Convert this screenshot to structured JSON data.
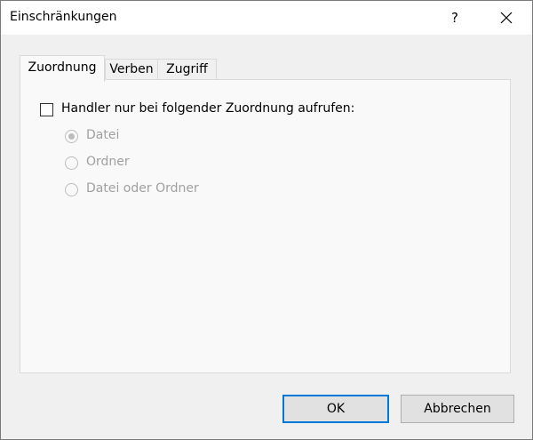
{
  "window": {
    "title": "Einschränkungen",
    "help_label": "?"
  },
  "tabs": [
    {
      "label": "Zuordnung",
      "active": true
    },
    {
      "label": "Verben",
      "active": false
    },
    {
      "label": "Zugriff",
      "active": false
    }
  ],
  "zuordnung": {
    "checkbox_label": "Handler nur bei folgender Zuordnung aufrufen:",
    "checkbox_checked": false,
    "options": [
      {
        "label": "Datei",
        "selected": true,
        "enabled": false
      },
      {
        "label": "Ordner",
        "selected": false,
        "enabled": false
      },
      {
        "label": "Datei oder Ordner",
        "selected": false,
        "enabled": false
      }
    ]
  },
  "buttons": {
    "ok_label": "OK",
    "cancel_label": "Abbrechen"
  },
  "colors": {
    "accent": "#0078d7",
    "disabled_text": "#a0a0a0"
  }
}
